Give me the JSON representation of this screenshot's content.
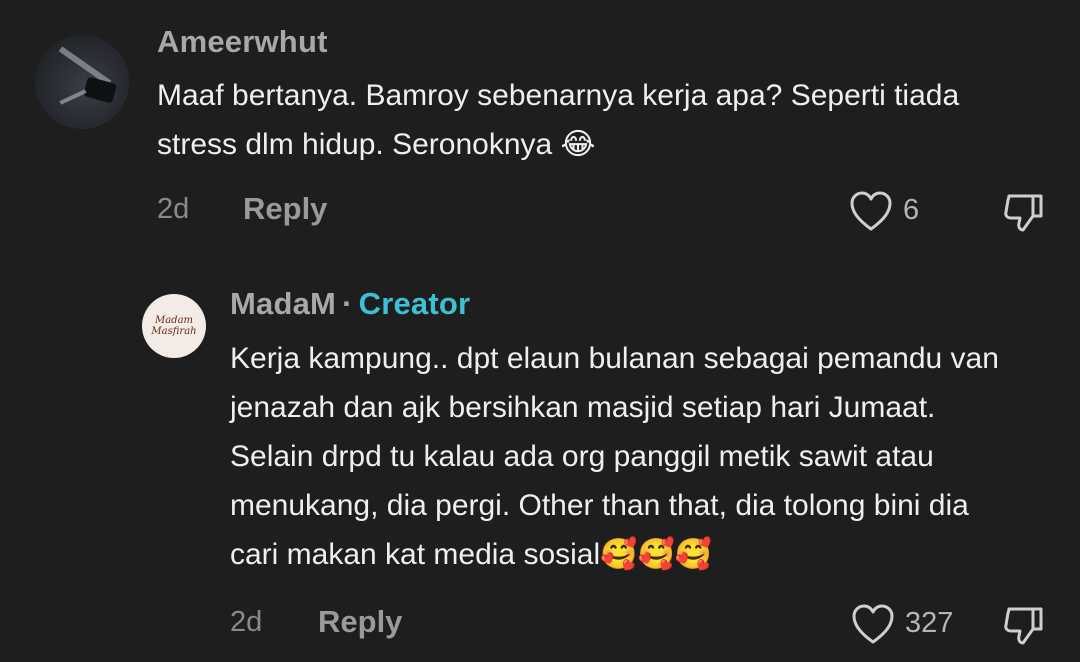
{
  "comment": {
    "username": "Ameerwhut",
    "text_line1": "Maaf bertanya. Bamroy sebenarnya kerja apa? Seperti tiada",
    "text_line2": "stress dlm hidup. Seronoknya",
    "emoji": "😂",
    "time": "2d",
    "reply_label": "Reply",
    "likes": "6"
  },
  "reply": {
    "username": "MadaM",
    "separator": "·",
    "badge": "Creator",
    "avatar_text_line1": "Madam",
    "avatar_text_line2": "Masfirah",
    "lines": [
      "Kerja kampung.. dpt elaun bulanan sebagai pemandu van",
      "jenazah dan ajk bersihkan masjid setiap hari Jumaat.",
      "Selain drpd tu kalau ada org panggil metik sawit atau",
      "menukang, dia pergi. Other than that, dia tolong bini dia",
      "cari makan kat media sosial"
    ],
    "emojis": "🥰🥰🥰",
    "time": "2d",
    "reply_label": "Reply",
    "likes": "327"
  },
  "icons": {
    "like": "heart-outline-icon",
    "dislike": "thumbs-down-icon"
  },
  "colors": {
    "background": "#1e1e1e",
    "creator_badge": "#3cc1d6"
  }
}
